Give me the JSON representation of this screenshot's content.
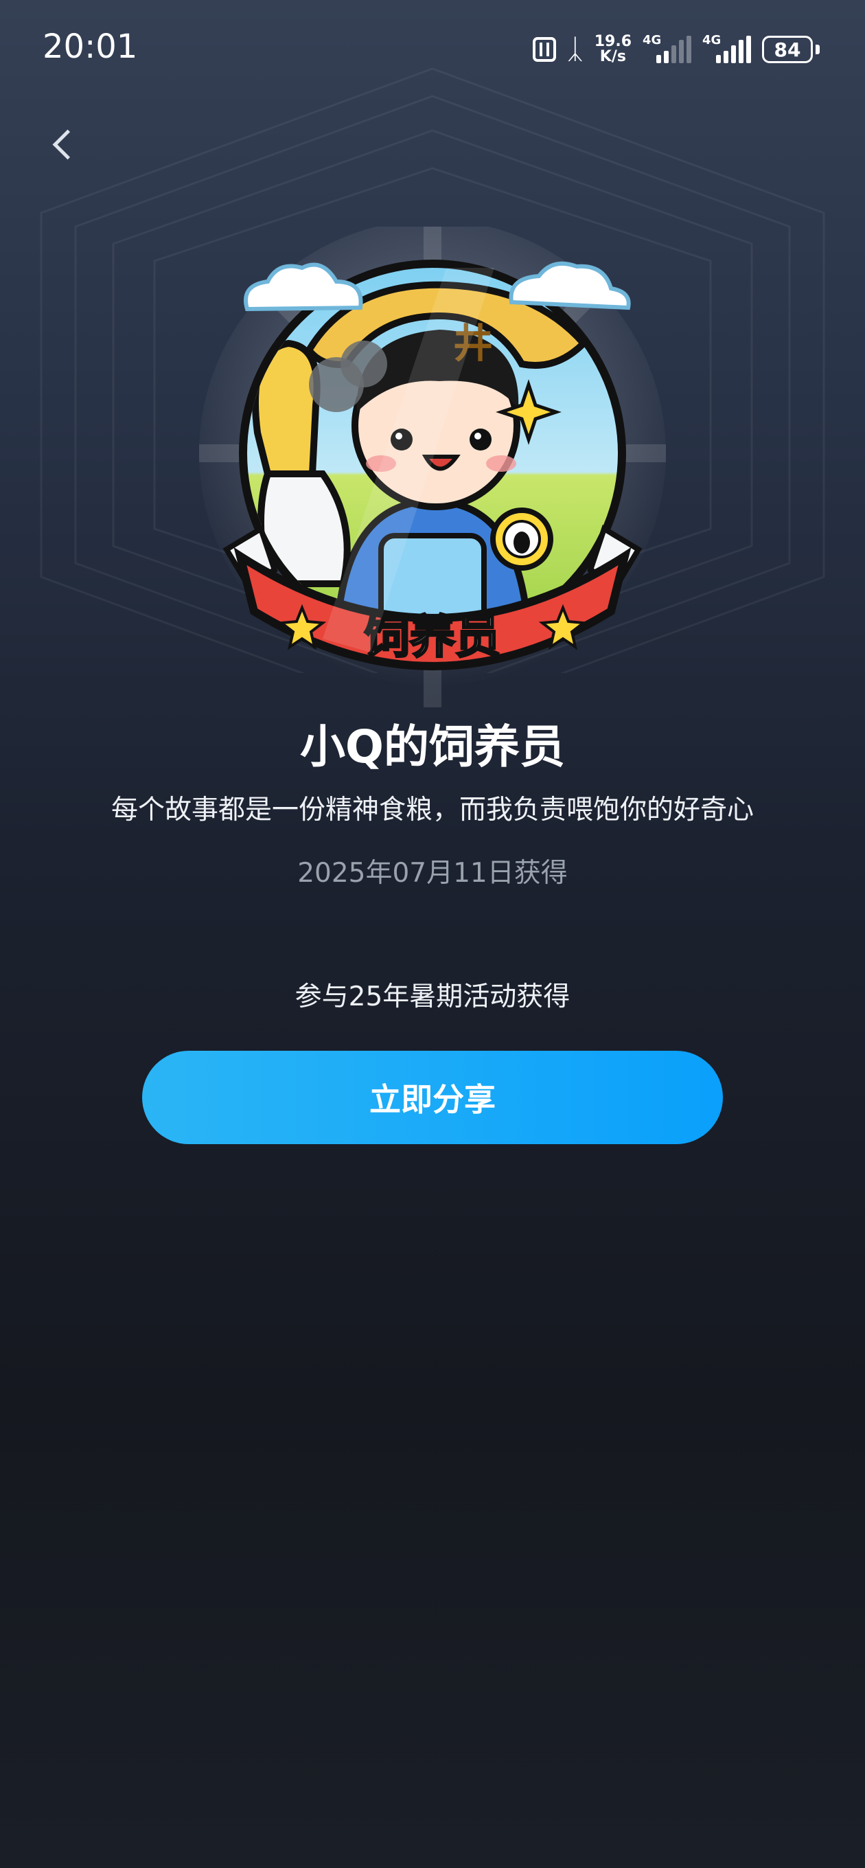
{
  "status_bar": {
    "time": "20:01",
    "net_speed_value": "19.6",
    "net_speed_unit": "K/s",
    "sim1_label": "4G",
    "sim2_label": "4G",
    "battery": "84"
  },
  "nav": {
    "back_icon": "chevron-left-icon"
  },
  "badge": {
    "ribbon_text": "饲养员",
    "colors": {
      "ribbon": "#e8443a",
      "outline": "#111111",
      "sky": "#7fd0f2",
      "grass": "#c8e66a",
      "hat": "#f2c34b"
    }
  },
  "achievement": {
    "title": "小Q的饲养员",
    "description": "每个故事都是一份精神食粮，而我负责喂饱你的好奇心",
    "obtained_date": "2025年07月11日获得",
    "source": "参与25年暑期活动获得"
  },
  "share_button": {
    "label": "立即分享",
    "color": "#14a8f9"
  }
}
